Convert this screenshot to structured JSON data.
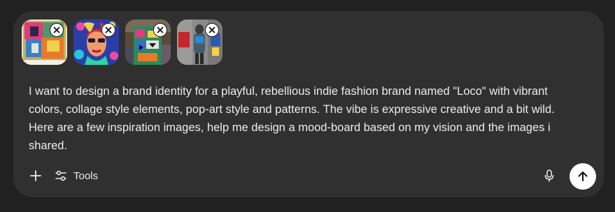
{
  "composer": {
    "attachments": [
      {
        "name": "inspiration-image-1",
        "icon": "collage-image"
      },
      {
        "name": "inspiration-image-2",
        "icon": "pop-art-portrait-image"
      },
      {
        "name": "inspiration-image-3",
        "icon": "patterned-garment-image"
      },
      {
        "name": "inspiration-image-4",
        "icon": "street-fashion-image"
      }
    ],
    "remove_icon": "close-icon",
    "prompt_text": "I want to design a brand identity for a playful, rebellious indie fashion brand named \"Loco\" with vibrant colors, collage style elements, pop-art style and patterns. The vibe is expressive creative and a bit wild. Here are a few inspiration images, help me design a mood-board based on my vision and the images i shared.",
    "toolbar": {
      "plus_icon": "plus-icon",
      "tools_icon": "sliders-icon",
      "tools_label": "Tools",
      "mic_icon": "microphone-icon",
      "send_icon": "arrow-up-icon"
    }
  },
  "colors": {
    "background": "#212121",
    "composer": "#303030",
    "text": "#ececec",
    "send_button": "#ffffff"
  }
}
